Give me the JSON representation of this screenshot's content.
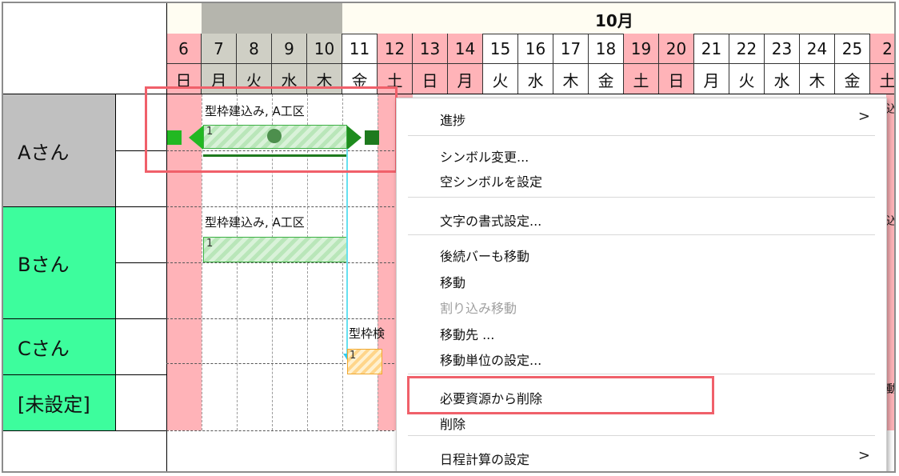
{
  "header": {
    "month_label": "10月"
  },
  "days": [
    {
      "d": "6",
      "w": "日",
      "type": "red"
    },
    {
      "d": "7",
      "w": "月",
      "type": "grey"
    },
    {
      "d": "8",
      "w": "火",
      "type": "grey"
    },
    {
      "d": "9",
      "w": "水",
      "type": "grey"
    },
    {
      "d": "10",
      "w": "木",
      "type": "grey"
    },
    {
      "d": "11",
      "w": "金",
      "type": "normal"
    },
    {
      "d": "12",
      "w": "土",
      "type": "red"
    },
    {
      "d": "13",
      "w": "日",
      "type": "red"
    },
    {
      "d": "14",
      "w": "月",
      "type": "red"
    },
    {
      "d": "15",
      "w": "火",
      "type": "normal"
    },
    {
      "d": "16",
      "w": "水",
      "type": "normal"
    },
    {
      "d": "17",
      "w": "木",
      "type": "normal"
    },
    {
      "d": "18",
      "w": "金",
      "type": "normal"
    },
    {
      "d": "19",
      "w": "土",
      "type": "red"
    },
    {
      "d": "20",
      "w": "日",
      "type": "red"
    },
    {
      "d": "21",
      "w": "月",
      "type": "normal"
    },
    {
      "d": "22",
      "w": "火",
      "type": "normal"
    },
    {
      "d": "23",
      "w": "水",
      "type": "normal"
    },
    {
      "d": "24",
      "w": "木",
      "type": "normal"
    },
    {
      "d": "25",
      "w": "金",
      "type": "normal"
    },
    {
      "d": "2",
      "w": "土",
      "type": "red"
    }
  ],
  "resources": {
    "a": "Aさん",
    "b": "Bさん",
    "c": "Cさん",
    "unset": "[未設定]"
  },
  "tasks": {
    "a_label": "型枠建込み, A工区",
    "a_num": "1",
    "b_label": "型枠建込み, A工区",
    "b_num": "1",
    "c_label": "型枠検",
    "c_num": "1"
  },
  "context_menu": {
    "progress": "進捗",
    "change_symbol": "シンボル変更...",
    "set_empty_symbol": "空シンボルを設定",
    "text_format": "文字の書式設定...",
    "move_following": "後続バーも移動",
    "move": "移動",
    "insert_move": "割り込み移動",
    "move_to": "移動先 ...",
    "move_unit": "移動単位の設定...",
    "remove_from_resource": "必要資源から削除",
    "delete": "削除",
    "schedule_calc": "日程計算の設定",
    "submenu_arrow": ">"
  },
  "colors": {
    "weekend_red": "#ffb3b8",
    "selected_grey": "#cfcfc5",
    "resource_green": "#3dfd9d",
    "resource_grey": "#c0c0c0",
    "highlight": "#f0606a",
    "bar_green": "#3cb043"
  }
}
